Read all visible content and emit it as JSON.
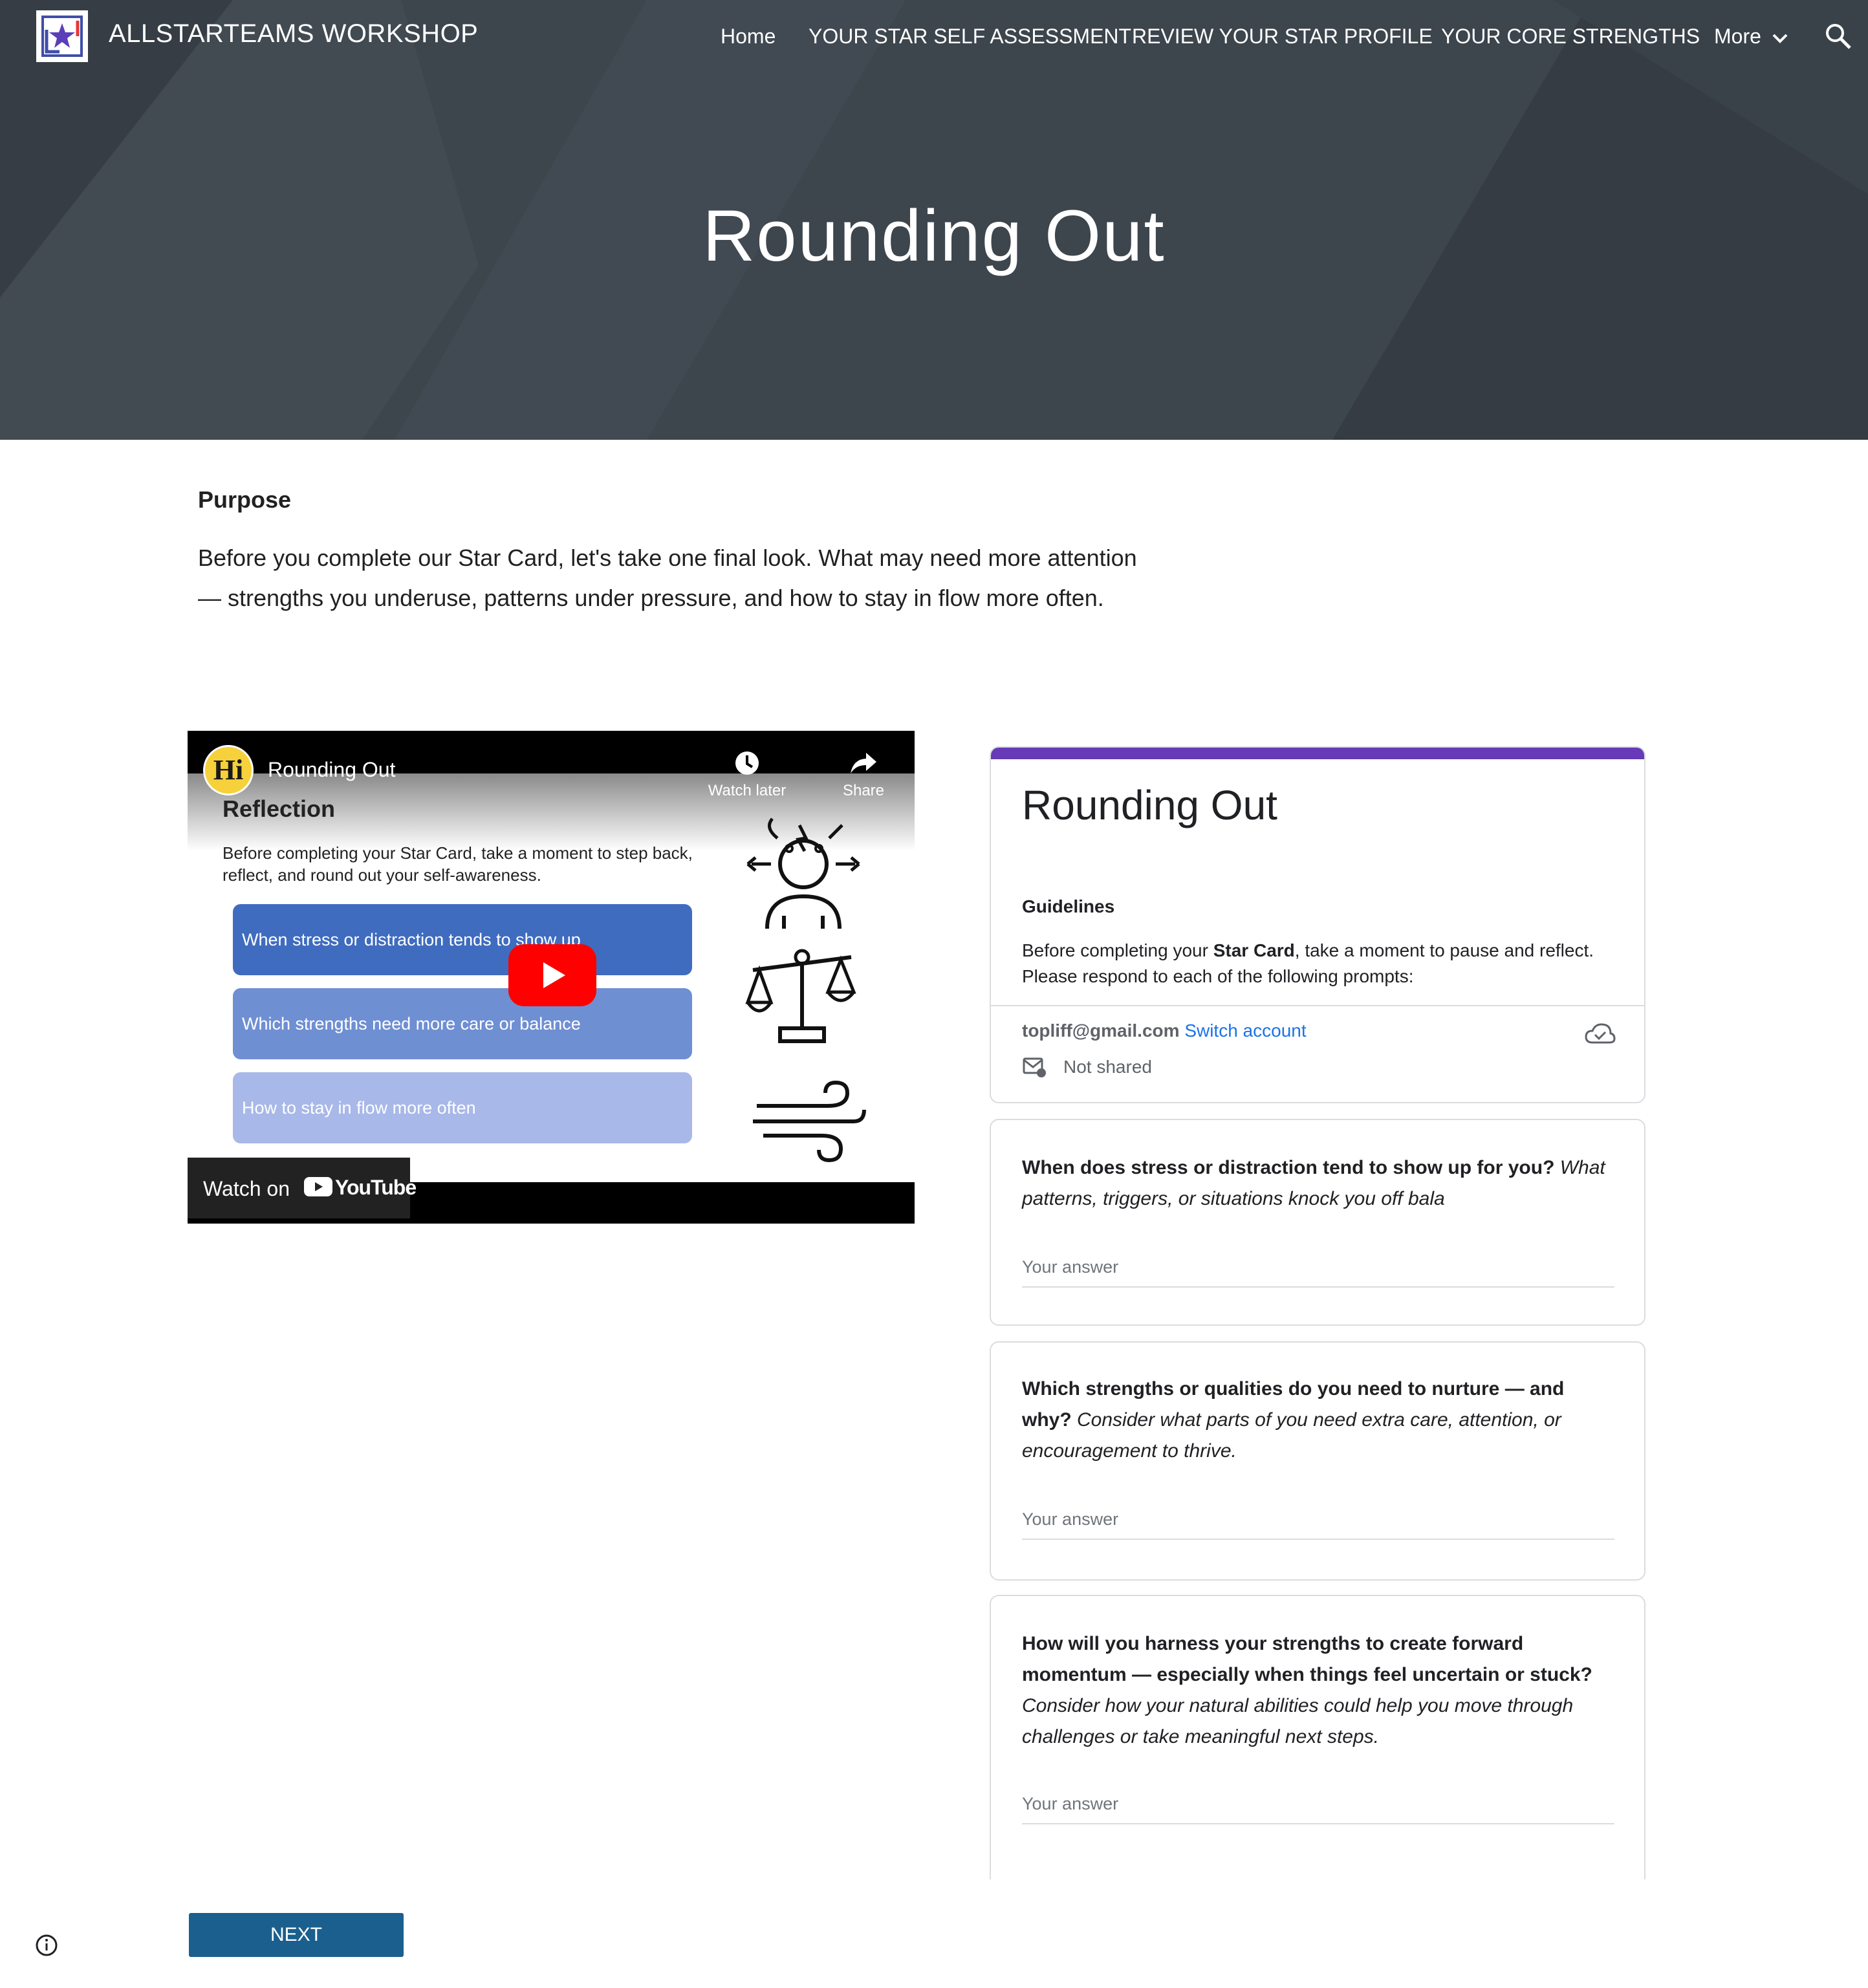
{
  "site": {
    "title": "ALLSTARTEAMS WORKSHOP",
    "nav": [
      "Home",
      "YOUR STAR SELF ASSESSMENT",
      "REVIEW YOUR STAR PROFILE",
      "YOUR CORE STRENGTHS"
    ],
    "more_label": "More",
    "colors": {
      "header_bg": "#3d454d",
      "next_button": "#1a5f8e",
      "form_accent": "#673ab7",
      "link": "#1a73e8"
    }
  },
  "hero": {
    "title": "Rounding Out"
  },
  "purpose": {
    "heading": "Purpose",
    "text": "Before you complete our Star Card, let's take one final look. What may need more attention — strengths you underuse, patterns under pressure, and how to stay in flow more often."
  },
  "video": {
    "channel_badge": "Hi",
    "title": "Rounding Out",
    "watch_later": "Watch later",
    "share": "Share",
    "slide_heading": "Reflection",
    "slide_text": "Before completing your Star Card, take a moment to step back, reflect, and round out your self-awareness.",
    "pills": [
      "When stress or distraction tends to show up",
      "Which strengths need more care or balance",
      "How to stay in flow more often"
    ],
    "watch_on": "Watch on",
    "youtube": "YouTube"
  },
  "form": {
    "title": "Rounding Out",
    "guidelines_heading": "Guidelines",
    "guidelines_pre": "Before completing your ",
    "guidelines_bold": "Star Card",
    "guidelines_post": ", take a moment to pause and reflect. Please respond to each of the following prompts:",
    "email": "topliff@gmail.com",
    "switch_account": "Switch account",
    "not_shared": "Not shared",
    "answer_placeholder": "Your answer",
    "questions": [
      {
        "bold": " When does stress or distraction tend to show up for you?",
        "italic": " What patterns, triggers, or situations knock you off bala"
      },
      {
        "bold": "Which strengths or qualities do you need to nurture — and why?",
        "italic": " Consider what parts of you need extra care, attention, or encouragement to thrive."
      },
      {
        "bold": "How will you harness your strengths to create forward momentum — especially when things feel uncertain or stuck?",
        "italic": " Consider how your natural abilities could help you move through challenges or take meaningful next steps."
      }
    ]
  },
  "footer": {
    "next_label": "NEXT"
  }
}
